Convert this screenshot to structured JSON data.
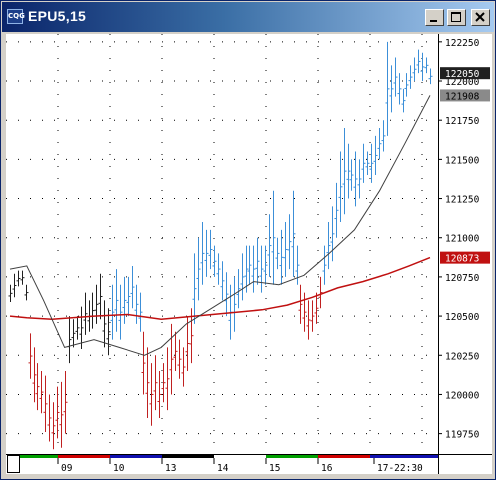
{
  "window": {
    "title": "EPU5,15",
    "app_icon": "cqg-logo-icon"
  },
  "buttons": {
    "minimize": "minimize-icon",
    "maximize": "maximize-icon",
    "close": "close-icon"
  },
  "colors": {
    "up_bar": "#3c8fd8",
    "down_bar": "#c02020",
    "neutral_bar": "#202020",
    "ma_slow": "#c01010",
    "ma_fast": "#404040"
  },
  "chart_data": {
    "type": "bar",
    "symbol": "EPU5",
    "interval": "15",
    "y_ticks": [
      122250,
      122000,
      121750,
      121500,
      121250,
      121000,
      120750,
      120500,
      120250,
      120000,
      119750
    ],
    "ylim": [
      119620,
      122300
    ],
    "x_ticks": [
      "09",
      "10",
      "13",
      "14",
      "15",
      "16",
      "17-22:30"
    ],
    "price_labels": [
      {
        "text": "122050",
        "value": 122050,
        "style": "dark"
      },
      {
        "text": "121908",
        "value": 121908,
        "style": "gray"
      },
      {
        "text": "120873",
        "value": 120873,
        "style": "red"
      }
    ],
    "ohlc_segments": [
      {
        "color": "black",
        "bars": [
          [
            120590,
            120700
          ],
          [
            120620,
            120770
          ],
          [
            120690,
            120790
          ],
          [
            120700,
            120790
          ],
          [
            120600,
            120700
          ]
        ]
      },
      {
        "color": "red",
        "bars": [
          [
            120100,
            120390
          ],
          [
            119950,
            120300
          ],
          [
            119900,
            120200
          ],
          [
            119880,
            120150
          ],
          [
            119760,
            120120
          ],
          [
            119700,
            120000
          ],
          [
            119650,
            119950
          ],
          [
            119720,
            120050
          ],
          [
            119660,
            120080
          ],
          [
            119750,
            120150
          ]
        ]
      },
      {
        "color": "black",
        "bars": [
          [
            120200,
            120500
          ],
          [
            120300,
            120480
          ],
          [
            120350,
            120500
          ],
          [
            120290,
            120560
          ],
          [
            120380,
            120650
          ],
          [
            120400,
            120600
          ],
          [
            120420,
            120650
          ],
          [
            120450,
            120700
          ],
          [
            120480,
            120770
          ],
          [
            120300,
            120600
          ],
          [
            120250,
            120550
          ]
        ]
      },
      {
        "color": "blue",
        "bars": [
          [
            120350,
            120700
          ],
          [
            120400,
            120800
          ],
          [
            120350,
            120700
          ],
          [
            120450,
            120750
          ],
          [
            120500,
            120750
          ],
          [
            120550,
            120820
          ],
          [
            120450,
            120700
          ],
          [
            120400,
            120650
          ]
        ]
      },
      {
        "color": "red",
        "bars": [
          [
            120000,
            120400
          ],
          [
            119850,
            120300
          ],
          [
            119800,
            120200
          ],
          [
            119900,
            120250
          ],
          [
            119850,
            120150
          ],
          [
            119950,
            120200
          ],
          [
            119900,
            120300
          ],
          [
            120000,
            120450
          ]
        ]
      },
      {
        "color": "red",
        "bars": [
          [
            120150,
            120400
          ],
          [
            120100,
            120350
          ],
          [
            120050,
            120300
          ],
          [
            120150,
            120500
          ],
          [
            120200,
            120550
          ]
        ]
      },
      {
        "color": "blue",
        "bars": [
          [
            120450,
            120900
          ],
          [
            120600,
            121000
          ],
          [
            120700,
            121100
          ],
          [
            120750,
            121050
          ],
          [
            120800,
            121050
          ],
          [
            120750,
            120950
          ],
          [
            120700,
            120900
          ],
          [
            120600,
            120850
          ],
          [
            120500,
            120780
          ],
          [
            120350,
            120700
          ],
          [
            120400,
            120750
          ],
          [
            120550,
            120800
          ],
          [
            120600,
            120900
          ],
          [
            120650,
            120950
          ],
          [
            120700,
            120950
          ],
          [
            120650,
            120950
          ],
          [
            120700,
            121000
          ],
          [
            120650,
            120950
          ],
          [
            120700,
            120950
          ],
          [
            120750,
            121150
          ],
          [
            120700,
            121300
          ],
          [
            120800,
            121000
          ],
          [
            120700,
            121050
          ],
          [
            120750,
            121100
          ],
          [
            120800,
            121150
          ],
          [
            120750,
            121300
          ],
          [
            120700,
            120950
          ]
        ]
      },
      {
        "color": "red",
        "bars": [
          [
            120450,
            120700
          ],
          [
            120400,
            120650
          ],
          [
            120350,
            120600
          ],
          [
            120400,
            120600
          ],
          [
            120450,
            120650
          ],
          [
            120550,
            120750
          ]
        ]
      },
      {
        "color": "blue",
        "bars": [
          [
            120700,
            120950
          ],
          [
            120800,
            121100
          ],
          [
            120850,
            121200
          ],
          [
            121000,
            121350
          ],
          [
            121100,
            121550
          ],
          [
            121150,
            121700
          ],
          [
            121250,
            121600
          ],
          [
            121300,
            121500
          ],
          [
            121200,
            121550
          ],
          [
            121250,
            121500
          ],
          [
            121350,
            121600
          ],
          [
            121400,
            121550
          ],
          [
            121350,
            121600
          ],
          [
            121400,
            121650
          ],
          [
            121500,
            121700
          ],
          [
            121550,
            121750
          ],
          [
            121650,
            122250
          ],
          [
            121800,
            122100
          ],
          [
            121900,
            122150
          ],
          [
            121850,
            122050
          ],
          [
            121800,
            121950
          ],
          [
            121900,
            122050
          ],
          [
            121950,
            122100
          ],
          [
            122000,
            122150
          ],
          [
            122050,
            122200
          ],
          [
            122000,
            122180
          ],
          [
            122050,
            122150
          ],
          [
            121980,
            122080
          ]
        ]
      }
    ],
    "ma_slow_points": [
      [
        0,
        120500
      ],
      [
        0.04,
        120490
      ],
      [
        0.1,
        120480
      ],
      [
        0.2,
        120500
      ],
      [
        0.28,
        120510
      ],
      [
        0.36,
        120480
      ],
      [
        0.44,
        120500
      ],
      [
        0.52,
        120520
      ],
      [
        0.6,
        120540
      ],
      [
        0.66,
        120570
      ],
      [
        0.72,
        120620
      ],
      [
        0.78,
        120680
      ],
      [
        0.84,
        120720
      ],
      [
        0.9,
        120770
      ],
      [
        0.95,
        120820
      ],
      [
        1,
        120873
      ]
    ],
    "ma_fast_points": [
      [
        0,
        120800
      ],
      [
        0.04,
        120820
      ],
      [
        0.08,
        120600
      ],
      [
        0.13,
        120300
      ],
      [
        0.2,
        120350
      ],
      [
        0.26,
        120300
      ],
      [
        0.32,
        120250
      ],
      [
        0.36,
        120300
      ],
      [
        0.42,
        120450
      ],
      [
        0.48,
        120550
      ],
      [
        0.54,
        120650
      ],
      [
        0.58,
        120720
      ],
      [
        0.64,
        120700
      ],
      [
        0.7,
        120760
      ],
      [
        0.76,
        120900
      ],
      [
        0.82,
        121050
      ],
      [
        0.88,
        121300
      ],
      [
        0.94,
        121600
      ],
      [
        1,
        121908
      ]
    ]
  }
}
